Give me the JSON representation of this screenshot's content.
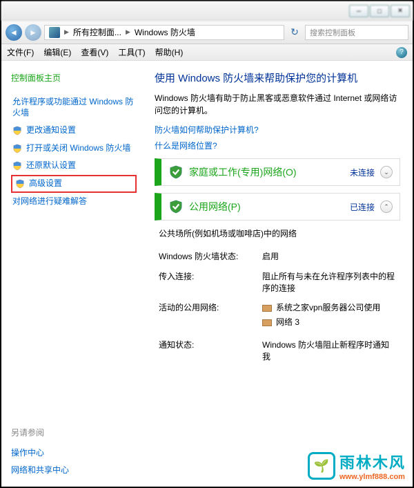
{
  "window": {
    "min": "─",
    "max": "□",
    "close": "✕"
  },
  "nav": {
    "breadcrumb1": "所有控制面...",
    "breadcrumb2": "Windows 防火墙",
    "searchPlaceholder": "搜索控制面板"
  },
  "menu": {
    "file": "文件(F)",
    "edit": "编辑(E)",
    "view": "查看(V)",
    "tools": "工具(T)",
    "help": "帮助(H)"
  },
  "sidebar": {
    "home": "控制面板主页",
    "items": {
      "0": {
        "label": "允许程序或功能通过 Windows 防火墙"
      },
      "1": {
        "label": "更改通知设置"
      },
      "2": {
        "label": "打开或关闭 Windows 防火墙"
      },
      "3": {
        "label": "还原默认设置"
      },
      "4": {
        "label": "高级设置"
      },
      "5": {
        "label": "对网络进行疑难解答"
      }
    },
    "seeAlsoTitle": "另请参阅",
    "seeAlso": {
      "0": "操作中心",
      "1": "网络和共享中心"
    }
  },
  "main": {
    "title": "使用 Windows 防火墙来帮助保护您的计算机",
    "desc": "Windows 防火墙有助于防止黑客或恶意软件通过 Internet 或网络访问您的计算机。",
    "link1": "防火墙如何帮助保护计算机?",
    "link2": "什么是网络位置?",
    "net1": {
      "title": "家庭或工作(专用)网络(O)",
      "status": "未连接"
    },
    "net2": {
      "title": "公用网络(P)",
      "status": "已连接",
      "desc": "公共场所(例如机场或咖啡店)中的网络",
      "rows": {
        "0": {
          "label": "Windows 防火墙状态:",
          "value": "启用"
        },
        "1": {
          "label": "传入连接:",
          "value": "阻止所有与未在允许程序列表中的程序的连接"
        },
        "2": {
          "label": "活动的公用网络:",
          "value1": "系统之家vpn服务器公司使用",
          "value2": "网络 3"
        },
        "3": {
          "label": "通知状态:",
          "value": "Windows 防火墙阻止新程序时通知我"
        }
      }
    }
  },
  "watermark": {
    "text": "雨林木风",
    "url": "www.ylmf888.com"
  }
}
